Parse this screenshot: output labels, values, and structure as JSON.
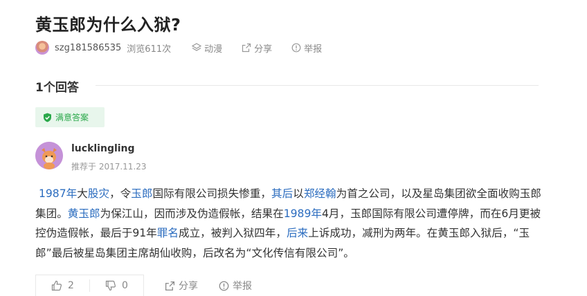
{
  "question": {
    "title": "黄玉郎为什么入狱?",
    "asker": "szg181586535",
    "views": "浏览611次",
    "actions": {
      "follow": "动漫",
      "share": "分享",
      "report": "举报"
    }
  },
  "answers_header": "1个回答",
  "answer": {
    "badge": "满意答案",
    "user": "lucklingling",
    "date": "推荐于 2017.11.23",
    "body": [
      {
        "t": "1987年",
        "link": true
      },
      {
        "t": "大",
        "link": false
      },
      {
        "t": "股灾",
        "link": true
      },
      {
        "t": "，令",
        "link": false
      },
      {
        "t": "玉郎",
        "link": true
      },
      {
        "t": "国际有限公司损失惨重，",
        "link": false
      },
      {
        "t": "其后",
        "link": true
      },
      {
        "t": "以",
        "link": false
      },
      {
        "t": "郑经翰",
        "link": true
      },
      {
        "t": "为首之公司，以及星岛集团欲全面收购玉郎集团。",
        "link": false
      },
      {
        "t": "黄玉郎",
        "link": true
      },
      {
        "t": "为保江山，因而涉及伪造假帐，结果在",
        "link": false
      },
      {
        "t": "1989年",
        "link": true
      },
      {
        "t": "4月，玉郎国际有限公司遭停牌，而在6月更被控伪造假帐，最后于91年",
        "link": false
      },
      {
        "t": "罪名",
        "link": true
      },
      {
        "t": "成立，被判入狱四年，",
        "link": false
      },
      {
        "t": "后来",
        "link": true
      },
      {
        "t": "上诉成功，减刑为两年。在黄玉郎入狱后，“玉郎”最后被星岛集团主席胡仙收购，后改名为“文化传信有限公司”。",
        "link": false
      }
    ],
    "footer": {
      "likes": "2",
      "dislikes": "0",
      "share": "分享",
      "report": "举报"
    }
  },
  "colors": {
    "link": "#2b6cbf",
    "badge_text": "#2aa84a",
    "badge_bg": "#e8f6ec"
  }
}
